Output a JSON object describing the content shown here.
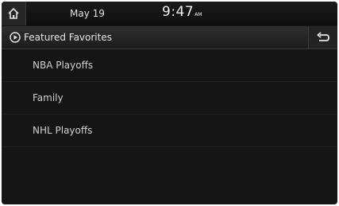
{
  "status_bar": {
    "date": "May 19",
    "time": "9:47",
    "am_pm": "AM"
  },
  "header": {
    "title": "Featured Favorites"
  },
  "list": {
    "items": [
      "NBA Playoffs",
      "Family",
      "NHL Playoffs"
    ]
  },
  "colors": {
    "background": "#151515",
    "text": "#d8d8d8",
    "bar": "#262626"
  },
  "icons": {
    "home": "home-icon",
    "play": "play-circle-icon",
    "back": "back-arrow-icon"
  }
}
